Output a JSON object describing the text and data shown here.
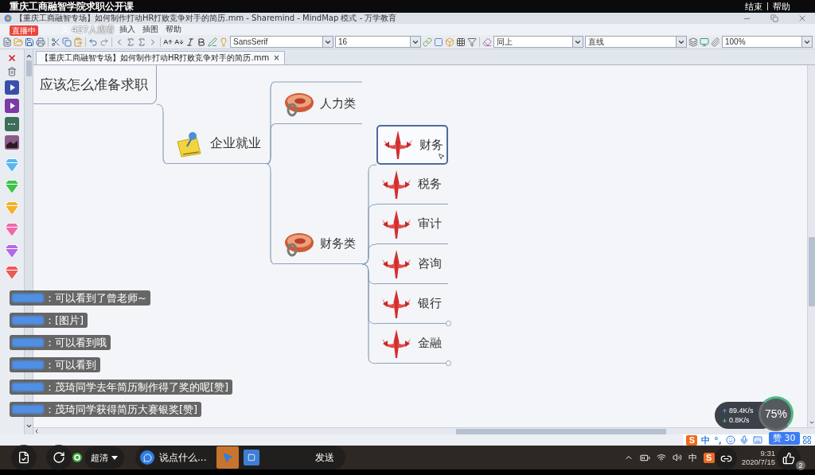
{
  "stream": {
    "title": "重庆工商融智学院求职公开课",
    "live_badge": "直播中",
    "viewers": "427人观看",
    "actions": [
      "结束",
      "帮助"
    ]
  },
  "window": {
    "title": "【重庆工商融智专场】如何制作打动HR打败竞争对手的简历.mm - Sharemind - MindMap 模式 - 万学教育"
  },
  "menu": [
    "插入",
    "插图",
    "帮助"
  ],
  "toolbar": {
    "font": "SansSerif",
    "font_size": "16",
    "style": "同上",
    "line_style": "直线",
    "zoom": "100%"
  },
  "tab": {
    "label": "【重庆工商融智专场】如何制作打动HR打败竞争对手的简历.mm",
    "close": "×",
    "selected": true
  },
  "mindmap": {
    "root": {
      "label": "应该怎么准备求职"
    },
    "branch": {
      "label": "企业就业",
      "selected": false,
      "children": [
        {
          "label": "人力类",
          "selected": false,
          "folded": false
        },
        {
          "label": "财务类",
          "selected": false,
          "folded": false,
          "children": [
            {
              "label": "财务",
              "selected": true,
              "folded": false
            },
            {
              "label": "税务",
              "selected": false,
              "folded": false
            },
            {
              "label": "审计",
              "selected": false,
              "folded": false
            },
            {
              "label": "咨询",
              "selected": false,
              "folded": false
            },
            {
              "label": "银行",
              "selected": false,
              "folded": true
            },
            {
              "label": "金融",
              "selected": false,
              "folded": true
            }
          ]
        }
      ]
    }
  },
  "chat": [
    "：可以看到了曾老师~",
    "：[图片]",
    "：可以看到哦",
    "：可以看到",
    "：茂琦同学去年简历制作得了奖的呢[赞]",
    "：茂琦同学获得简历大赛银奖[赞]"
  ],
  "network": {
    "upload": "89.4K/s",
    "download": "0.8K/s",
    "usage": "75%"
  },
  "ime": {
    "logo": "S",
    "mode": "中",
    "punctuation": "°,"
  },
  "live_controls": {
    "quality": "超清",
    "comment_placeholder": "说点什么...",
    "send": "发送",
    "likes": "赞 30",
    "like_badge": "2"
  },
  "taskbar": {
    "ime": "中",
    "ime_logo": "S",
    "time": "9:31",
    "date": "2020/7/15"
  }
}
